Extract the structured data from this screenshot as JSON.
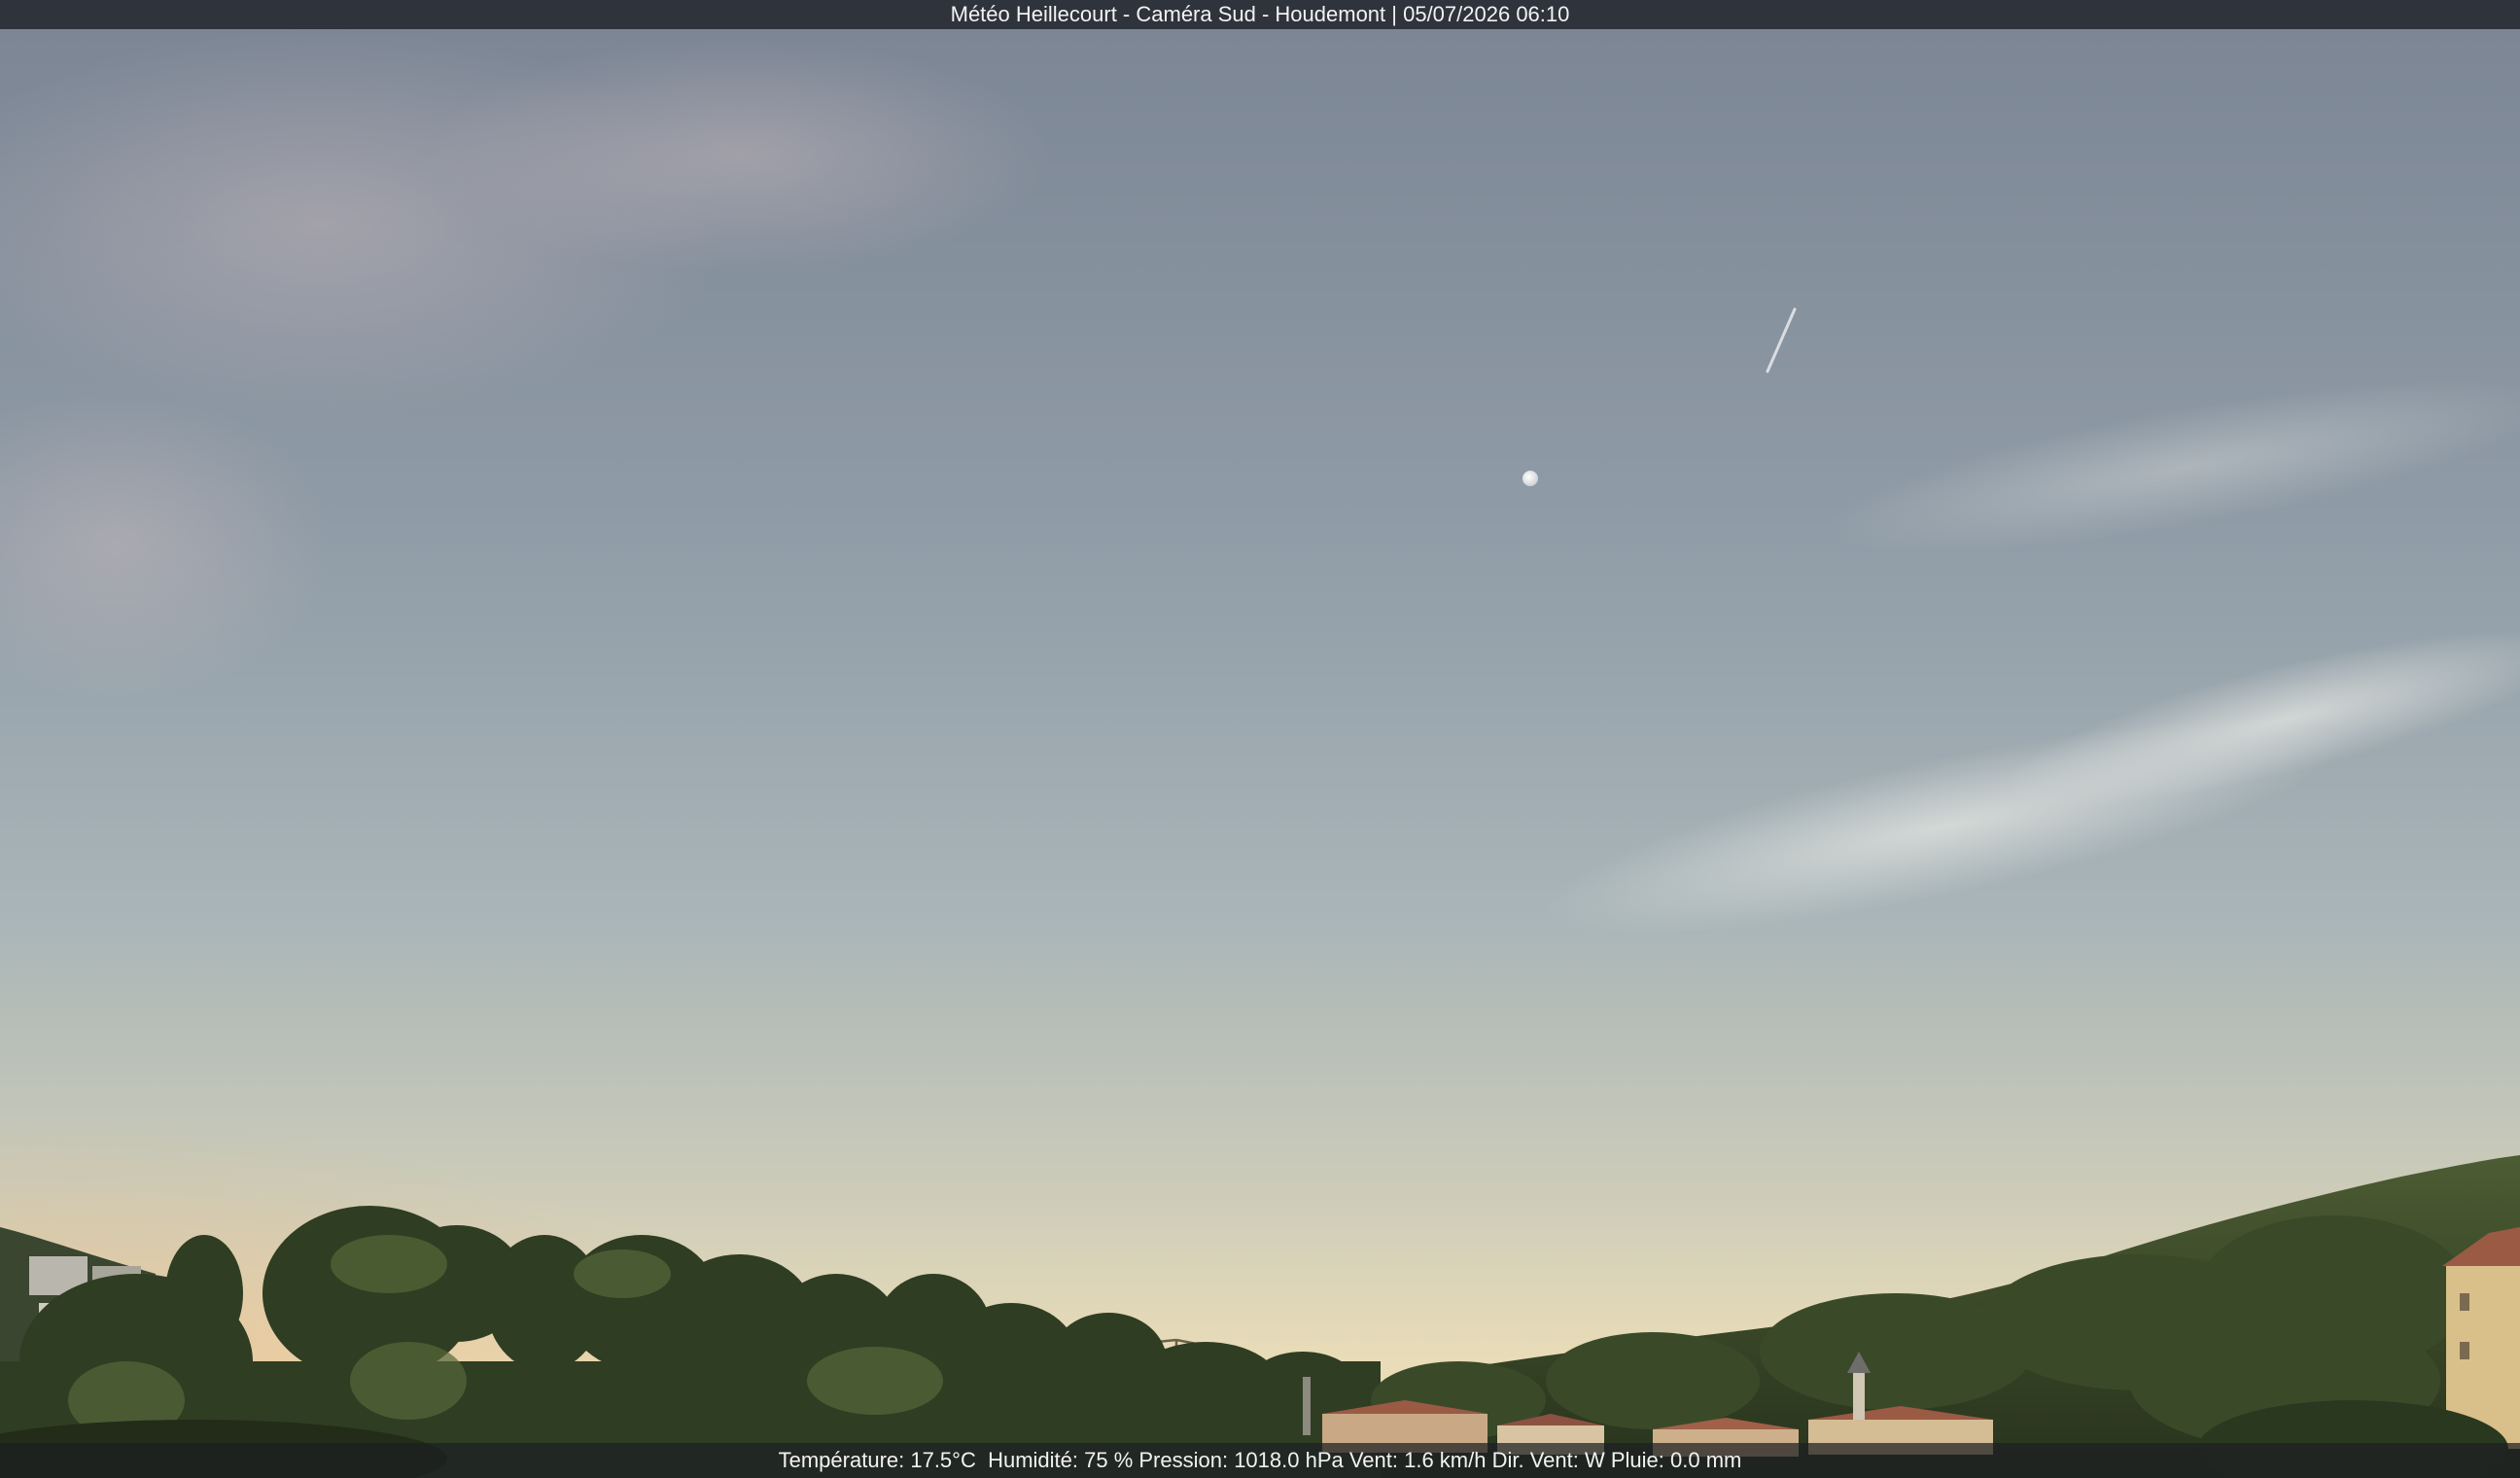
{
  "overlay": {
    "title": "Météo Heillecourt - Caméra Sud - Houdemont | 05/07/2026 06:10",
    "weather_line": "Température: 17.5°C  Humidité: 75 % Pression: 1018.0 hPa Vent: 1.6 km/h Dir. Vent: W Pluie: 0.0 mm"
  },
  "colors": {
    "sky_top": "#7d8795",
    "sky_mid": "#a7b3b8",
    "sky_horizon": "#e9dcb8",
    "horizon_glow": "#e6c79a",
    "vegetation": "#2f3d22",
    "vegetation_light": "#56683a",
    "roof": "#9a5a44",
    "wall": "#d9c08a",
    "overlay_bar": "#282c34",
    "overlay_text": "#f2f2f2"
  }
}
